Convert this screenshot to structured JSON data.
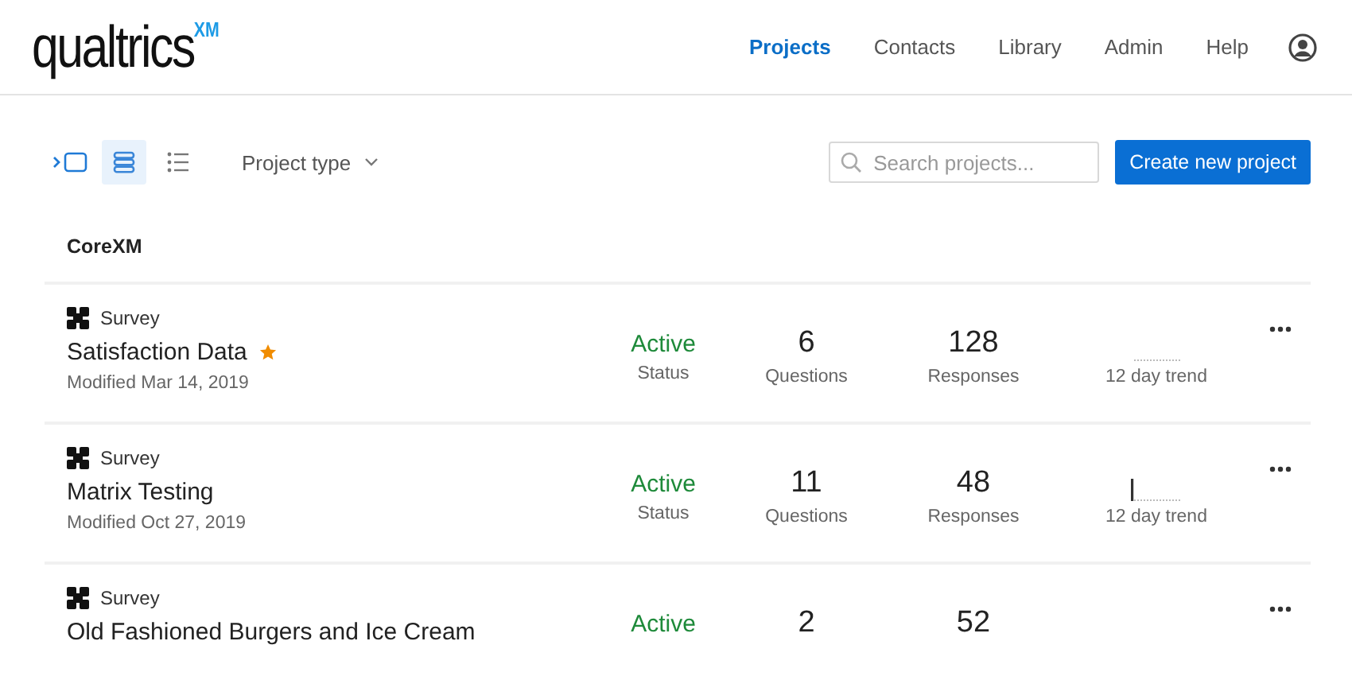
{
  "header": {
    "logo": "qualtrics",
    "logo_mark": "XM",
    "nav": [
      {
        "label": "Projects",
        "selected": true
      },
      {
        "label": "Contacts",
        "selected": false
      },
      {
        "label": "Library",
        "selected": false
      },
      {
        "label": "Admin",
        "selected": false
      },
      {
        "label": "Help",
        "selected": false
      }
    ]
  },
  "toolbar": {
    "views": [
      {
        "kind": "folder",
        "selected": false
      },
      {
        "kind": "cards",
        "selected": true
      },
      {
        "kind": "list",
        "selected": false
      }
    ],
    "filter": "Project type",
    "search": {
      "placeholder": "Search projects..."
    },
    "create_button": "Create new project"
  },
  "section": {
    "title": "CoreXM"
  },
  "projects": [
    {
      "type": "Survey",
      "name": "Satisfaction Data",
      "starred": true,
      "modified": "Modified Mar 14, 2019",
      "status": "Active",
      "status_label": "Status",
      "questions": "6",
      "questions_label": "Questions",
      "responses": "128",
      "responses_label": "Responses",
      "trend_spike": false,
      "trend_label": "12 day trend"
    },
    {
      "type": "Survey",
      "name": "Matrix Testing",
      "starred": false,
      "modified": "Modified Oct 27, 2019",
      "status": "Active",
      "status_label": "Status",
      "questions": "11",
      "questions_label": "Questions",
      "responses": "48",
      "responses_label": "Responses",
      "trend_spike": true,
      "trend_label": "12 day trend"
    },
    {
      "type": "Survey",
      "name": "Old Fashioned Burgers and Ice Cream",
      "starred": false,
      "status": "Active",
      "questions": "2",
      "responses": "52"
    }
  ]
}
